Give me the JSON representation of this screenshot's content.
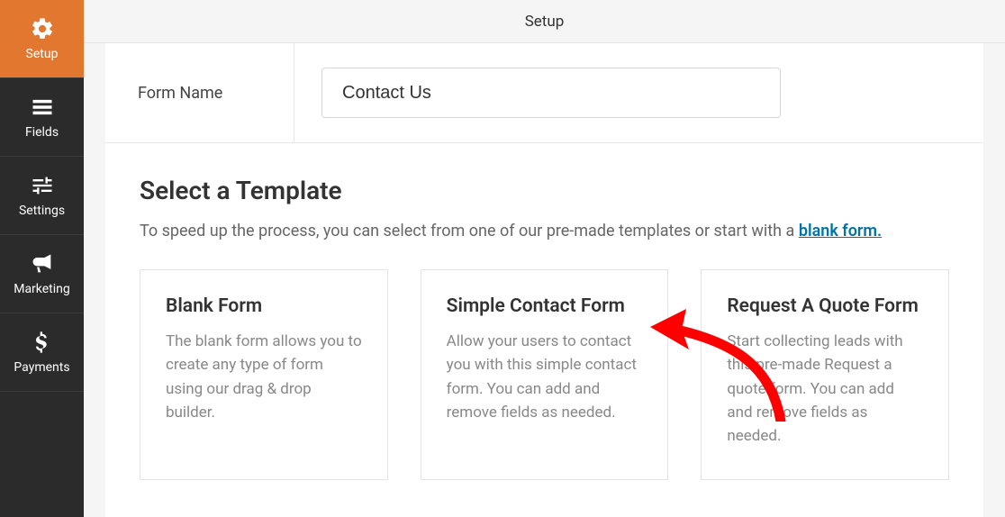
{
  "topbar": {
    "title": "Setup"
  },
  "sidebar": {
    "items": [
      {
        "label": "Setup"
      },
      {
        "label": "Fields"
      },
      {
        "label": "Settings"
      },
      {
        "label": "Marketing"
      },
      {
        "label": "Payments"
      }
    ]
  },
  "form_name": {
    "label": "Form Name",
    "value": "Contact Us"
  },
  "template": {
    "heading": "Select a Template",
    "intro_prefix": "To speed up the process, you can select from one of our pre-made templates or start with a ",
    "intro_link": "blank form.",
    "cards": [
      {
        "title": "Blank Form",
        "desc": "The blank form allows you to create any type of form using our drag & drop builder."
      },
      {
        "title": "Simple Contact Form",
        "desc": "Allow your users to contact you with this simple contact form. You can add and remove fields as needed."
      },
      {
        "title": "Request A Quote Form",
        "desc": "Start collecting leads with this pre-made Request a quote form. You can add and remove fields as needed."
      }
    ]
  },
  "colors": {
    "accent": "#e27730",
    "link": "#0073aa",
    "annotation": "#ff0000"
  }
}
